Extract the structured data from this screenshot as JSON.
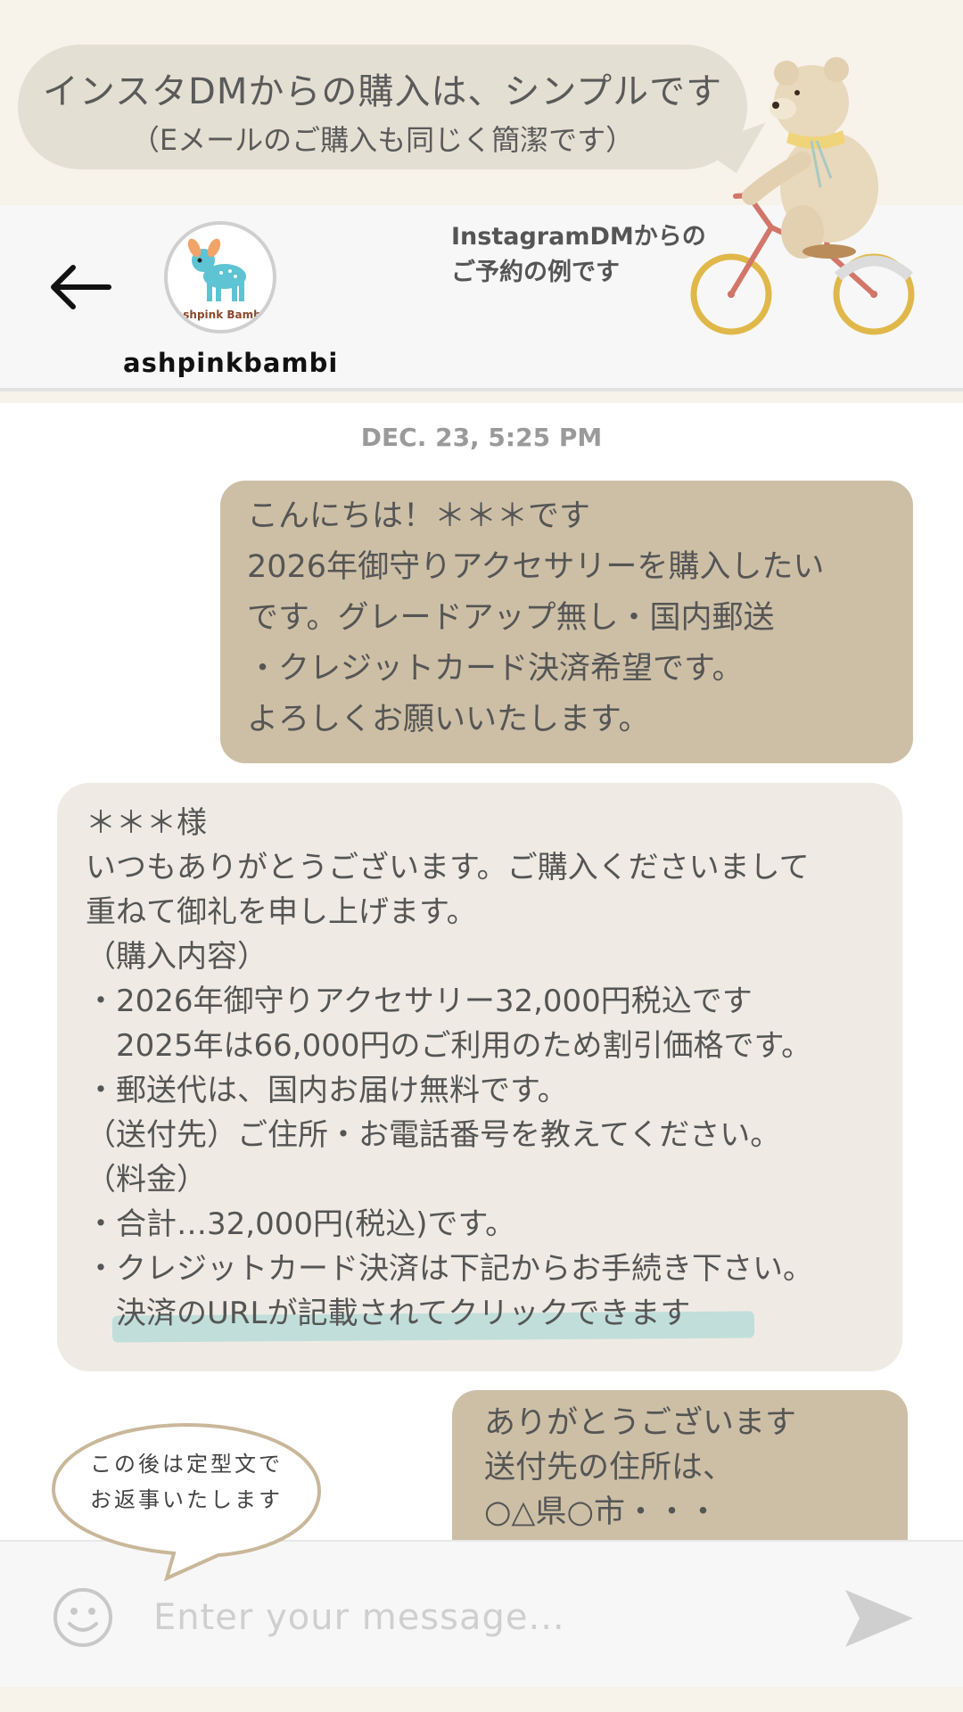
{
  "banner": {
    "headline": "インスタDMからの購入は、シンプルです",
    "subline": "（Eメールのご購入も同じく簡潔です）"
  },
  "header": {
    "username": "ashpinkbambi",
    "avatar_caption": "ashpink Bambi",
    "example_note_line1": "InstagramDMからの",
    "example_note_line2": "ご予約の例です"
  },
  "chat": {
    "timestamp": "DEC. 23, 5:25 PM",
    "messages": [
      {
        "side": "sent",
        "text": "こんにちは！＊＊＊です\n2026年御守りアクセサリーを購入したい\nです。グレードアップ無し・国内郵送\n・クレジットカード決済希望です。\nよろしくお願いいたします。"
      },
      {
        "side": "received",
        "text": "＊＊＊様\nいつもありがとうございます。ご購入くださいまして\n重ねて御礼を申し上げます。\n（購入内容）\n・2026年御守りアクセサリー32,000円税込です\n　2025年は66,000円のご利用のため割引価格です。\n・郵送代は、国内お届け無料です。\n（送付先）ご住所・お電話番号を教えてください。\n（料金）\n・合計…32,000円(税込)です。\n・クレジットカード決済は下記からお手続き下さい。\n　決済のURLが記載されてクリックできます"
      },
      {
        "side": "sent",
        "text": "ありがとうございます\n送付先の住所は、\n○△県○市・・・"
      }
    ]
  },
  "note": {
    "text": "この後は定型文で\nお返事いたします"
  },
  "input": {
    "placeholder": "Enter your message..."
  },
  "icons": {
    "back": "back-arrow-icon",
    "emoji": "smiley-icon",
    "send": "send-icon"
  },
  "colors": {
    "page_bg": "#f7f2ea",
    "sent_bubble": "#cdbfa6",
    "received_bubble": "#efebe4",
    "headline_bubble": "#e4dfd3",
    "highlight": "#b8dcd8"
  }
}
